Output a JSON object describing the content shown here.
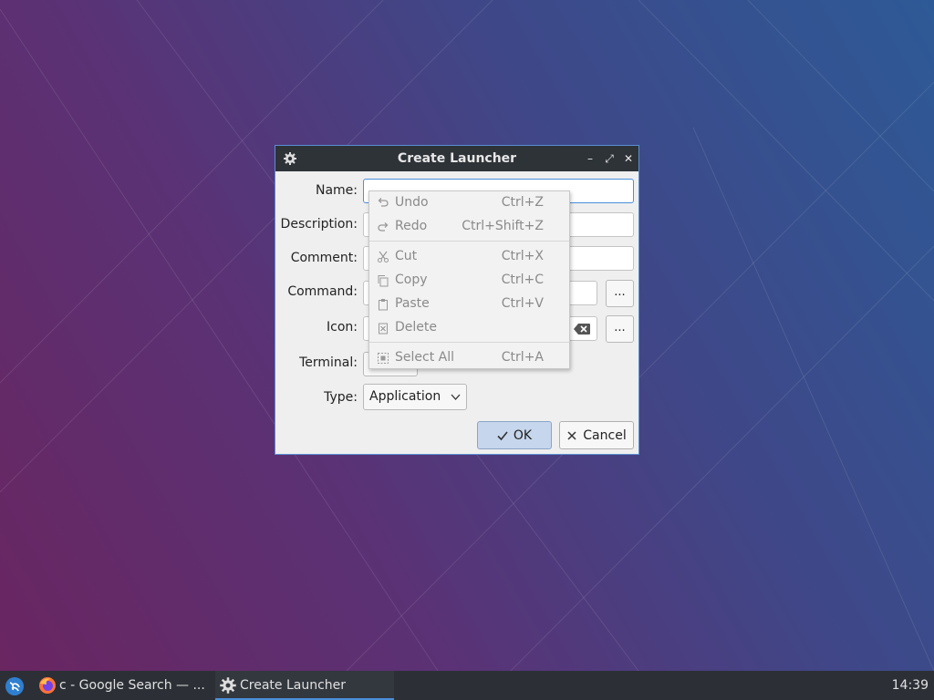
{
  "window": {
    "title": "Create Launcher",
    "controls": {
      "minimize": "–",
      "maximize": "⤢",
      "close": "✕"
    }
  },
  "form": {
    "name_label": "Name:",
    "name_value": "",
    "description_label": "Description:",
    "comment_label": "Comment:",
    "command_label": "Command:",
    "icon_label": "Icon:",
    "terminal_label": "Terminal:",
    "type_label": "Type:",
    "type_value": "Application",
    "browse_label": "...",
    "ok_label": "OK",
    "cancel_label": "Cancel"
  },
  "context_menu": {
    "items": [
      {
        "label": "Undo",
        "shortcut": "Ctrl+Z",
        "icon": "undo-icon"
      },
      {
        "label": "Redo",
        "shortcut": "Ctrl+Shift+Z",
        "icon": "redo-icon"
      },
      {
        "label": "Cut",
        "shortcut": "Ctrl+X",
        "icon": "cut-icon"
      },
      {
        "label": "Copy",
        "shortcut": "Ctrl+C",
        "icon": "copy-icon"
      },
      {
        "label": "Paste",
        "shortcut": "Ctrl+V",
        "icon": "paste-icon"
      },
      {
        "label": "Delete",
        "shortcut": "",
        "icon": "delete-icon"
      },
      {
        "label": "Select All",
        "shortcut": "Ctrl+A",
        "icon": "select-all-icon"
      }
    ]
  },
  "taskbar": {
    "tasks": [
      {
        "label": "c - Google Search — ...",
        "icon": "firefox-icon"
      },
      {
        "label": "Create Launcher",
        "icon": "launcher-gear-icon"
      }
    ],
    "clock": "14:39"
  },
  "colors": {
    "accent": "#4a90d9",
    "titlebar": "#2e3338",
    "taskbar": "#2c3036"
  }
}
